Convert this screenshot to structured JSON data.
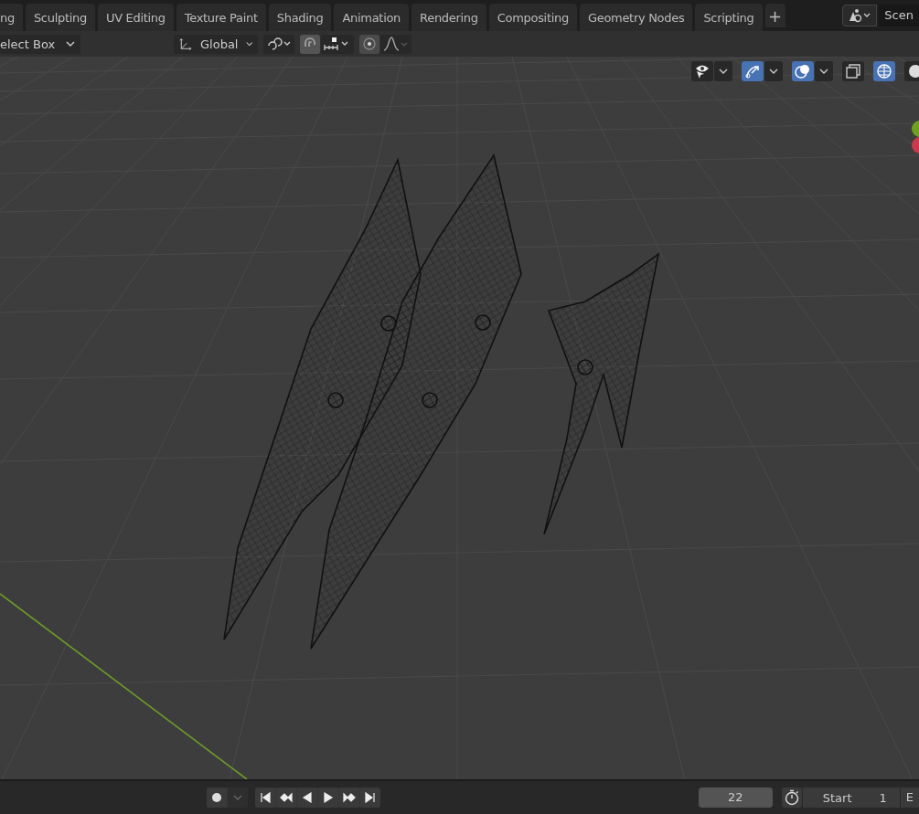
{
  "workspace_tabs": [
    {
      "label": "ng",
      "selected": false
    },
    {
      "label": "Sculpting",
      "selected": false
    },
    {
      "label": "UV Editing",
      "selected": false
    },
    {
      "label": "Texture Paint",
      "selected": false
    },
    {
      "label": "Shading",
      "selected": false
    },
    {
      "label": "Animation",
      "selected": false
    },
    {
      "label": "Rendering",
      "selected": false
    },
    {
      "label": "Compositing",
      "selected": false
    },
    {
      "label": "Geometry Nodes",
      "selected": false
    },
    {
      "label": "Scripting",
      "selected": false
    }
  ],
  "add_tab": "+",
  "scene": {
    "name": "Scen"
  },
  "header": {
    "select_mode": "elect Box",
    "orientation": "Global"
  },
  "viewport_buttons": [
    {
      "kind": "visibility",
      "selected": false,
      "dropdown": true
    },
    {
      "kind": "gizmos",
      "selected": true,
      "dropdown": true
    },
    {
      "kind": "overlays",
      "selected": true,
      "dropdown": true
    },
    {
      "kind": "xray",
      "selected": false,
      "dropdown": false
    },
    {
      "kind": "wireframe",
      "selected": true,
      "dropdown": false
    },
    {
      "kind": "solid",
      "selected": false,
      "dropdown": false
    }
  ],
  "timeline": {
    "current_frame": "22",
    "start_label": "Start",
    "start_value": "1",
    "end_label": "E"
  }
}
